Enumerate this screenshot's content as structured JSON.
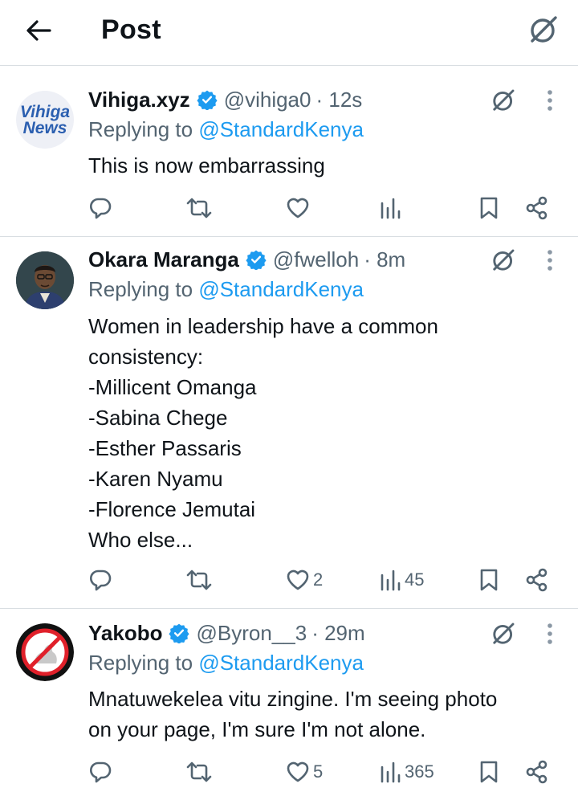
{
  "header": {
    "title": "Post"
  },
  "posts": [
    {
      "name": "Vihiga.xyz",
      "handle": "@vihiga0",
      "time": "· 12s",
      "avatar_text": [
        "Vihiga",
        "News"
      ],
      "reply_prefix": "Replying to",
      "reply_to": "@StandardKenya",
      "lines": [
        "This is now embarrassing"
      ],
      "likes": "",
      "views": ""
    },
    {
      "name": "Okara Maranga",
      "handle": "@fwelloh",
      "time": "· 8m",
      "reply_prefix": "Replying to",
      "reply_to": "@StandardKenya",
      "lines": [
        "Women in leadership have a common",
        "consistency:",
        "-Millicent Omanga",
        "-Sabina Chege",
        "-Esther Passaris",
        "-Karen Nyamu",
        "-Florence Jemutai",
        "Who else..."
      ],
      "likes": "2",
      "views": "45"
    },
    {
      "name": "Yakobo",
      "handle": "@Byron__3",
      "time": "· 29m",
      "reply_prefix": "Replying to",
      "reply_to": "@StandardKenya",
      "lines": [
        "Mnatuwekelea vitu zingine. I'm seeing photo",
        "on your page, I'm sure I'm not alone."
      ],
      "likes": "5",
      "views": "365"
    }
  ],
  "colors": {
    "text": "#0f1419",
    "secondary": "#536471",
    "link": "#1d9bf0",
    "divider": "#d9dee2",
    "verified": "#1d9bf0"
  },
  "icons": {
    "back": "arrow-left-icon",
    "grok": "grok-icon",
    "more": "more-vertical-icon",
    "reply": "reply-icon",
    "repost": "repost-icon",
    "like": "heart-icon",
    "views": "views-icon",
    "bookmark": "bookmark-icon",
    "share": "share-icon",
    "verified": "verified-badge-icon"
  }
}
